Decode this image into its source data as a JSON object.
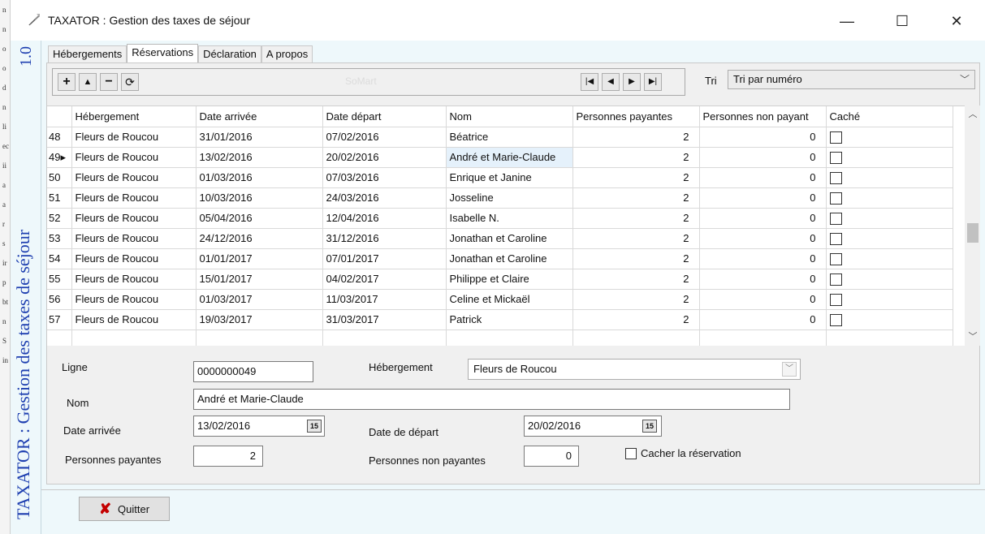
{
  "window": {
    "title": "TAXATOR : Gestion des taxes de séjour",
    "minimize": "—",
    "maximize": "☐",
    "close": "✕"
  },
  "side_banner": {
    "text": "TAXATOR : Gestion des taxes de séjour",
    "version": "1.0"
  },
  "tabs": [
    {
      "label": "Hébergements",
      "active": false
    },
    {
      "label": "Réservations",
      "active": true
    },
    {
      "label": "Déclaration",
      "active": false
    },
    {
      "label": "A propos",
      "active": false
    }
  ],
  "navigator": {
    "add": "+",
    "up": "▲",
    "delete": "−",
    "refresh": "⟳",
    "first": "|◀",
    "prev": "◀",
    "next": "▶",
    "last": "▶|",
    "center_text": "SoMart"
  },
  "sort": {
    "label": "Tri",
    "value": "Tri par numéro"
  },
  "grid": {
    "columns": [
      "",
      "Hébergement",
      "Date arrivée",
      "Date départ",
      "Nom",
      "Personnes payantes",
      "Personnes non payant",
      "Caché"
    ],
    "rows": [
      {
        "id": "48",
        "hebergement": "Fleurs de Roucou",
        "arrivee": "31/01/2016",
        "depart": "07/02/2016",
        "nom": "Béatrice",
        "payantes": "2",
        "non_payantes": "0",
        "cache": false
      },
      {
        "id": "49▸",
        "hebergement": "Fleurs de Roucou",
        "arrivee": "13/02/2016",
        "depart": "20/02/2016",
        "nom": "André et Marie-Claude",
        "payantes": "2",
        "non_payantes": "0",
        "cache": false,
        "selected": true
      },
      {
        "id": "50",
        "hebergement": "Fleurs de Roucou",
        "arrivee": "01/03/2016",
        "depart": "07/03/2016",
        "nom": "Enrique et Janine",
        "payantes": "2",
        "non_payantes": "0",
        "cache": false
      },
      {
        "id": "51",
        "hebergement": "Fleurs de Roucou",
        "arrivee": "10/03/2016",
        "depart": "24/03/2016",
        "nom": "Josseline",
        "payantes": "2",
        "non_payantes": "0",
        "cache": false
      },
      {
        "id": "52",
        "hebergement": "Fleurs de Roucou",
        "arrivee": "05/04/2016",
        "depart": "12/04/2016",
        "nom": "Isabelle N.",
        "payantes": "2",
        "non_payantes": "0",
        "cache": false
      },
      {
        "id": "53",
        "hebergement": "Fleurs de Roucou",
        "arrivee": "24/12/2016",
        "depart": "31/12/2016",
        "nom": "Jonathan et Caroline",
        "payantes": "2",
        "non_payantes": "0",
        "cache": false
      },
      {
        "id": "54",
        "hebergement": "Fleurs de Roucou",
        "arrivee": "01/01/2017",
        "depart": "07/01/2017",
        "nom": "Jonathan et Caroline",
        "payantes": "2",
        "non_payantes": "0",
        "cache": false
      },
      {
        "id": "55",
        "hebergement": "Fleurs de Roucou",
        "arrivee": "15/01/2017",
        "depart": "04/02/2017",
        "nom": "Philippe et Claire",
        "payantes": "2",
        "non_payantes": "0",
        "cache": false
      },
      {
        "id": "56",
        "hebergement": "Fleurs de Roucou",
        "arrivee": "01/03/2017",
        "depart": "11/03/2017",
        "nom": "Celine et Mickaël",
        "payantes": "2",
        "non_payantes": "0",
        "cache": false
      },
      {
        "id": "57",
        "hebergement": "Fleurs de Roucou",
        "arrivee": "19/03/2017",
        "depart": "31/03/2017",
        "nom": "Patrick",
        "payantes": "2",
        "non_payantes": "0",
        "cache": false
      }
    ]
  },
  "form": {
    "ligne_label": "Ligne",
    "ligne_value": "0000000049",
    "hebergement_label": "Hébergement",
    "hebergement_value": "Fleurs de Roucou",
    "nom_label": "Nom",
    "nom_value": "André et Marie-Claude",
    "arrivee_label": "Date arrivée",
    "arrivee_value": "13/02/2016",
    "depart_label": "Date de départ",
    "depart_value": "20/02/2016",
    "payantes_label": "Personnes payantes",
    "payantes_value": "2",
    "non_payantes_label": "Personnes non payantes",
    "non_payantes_value": "0",
    "cacher_label": "Cacher la réservation",
    "calendar_icon": "15"
  },
  "bottom": {
    "quit_label": "Quitter",
    "quit_icon": "✘"
  },
  "desktop_strip": [
    "n",
    "n",
    "o",
    "o",
    "d",
    "n",
    "li",
    "ec",
    "ii",
    "a",
    "a",
    "r",
    "s",
    "ir",
    "p",
    "bt",
    "n",
    "S",
    "in"
  ]
}
